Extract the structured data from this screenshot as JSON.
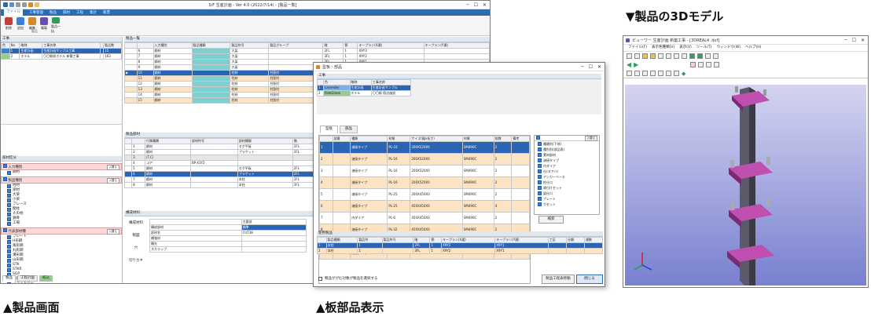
{
  "captions": {
    "product": "▲製品画面",
    "plate": "▲板部品表示",
    "model3d": "▼製品の3Dモデル"
  },
  "main": {
    "title": "S/F 生産計画 - Ver 4.0 (2022/7/14) - [製品一覧]",
    "menus": [
      {
        "label": "ファイル",
        "active": true
      },
      {
        "label": "工事管理",
        "active": false
      },
      {
        "label": "製品",
        "active": false
      },
      {
        "label": "部材",
        "active": false
      },
      {
        "label": "工程",
        "active": false
      },
      {
        "label": "集計",
        "active": false
      },
      {
        "label": "帳票",
        "active": false
      }
    ],
    "ribbon": [
      {
        "label": "削除",
        "color": "#c04040"
      },
      {
        "label": "追加",
        "color": "#3a7fd6"
      },
      {
        "label": "編集",
        "color": "#d08a2c"
      },
      {
        "label": "複製",
        "color": "#6a4fb3"
      },
      {
        "label": "製品一括",
        "color": "#2e9d5b"
      }
    ],
    "ribbon_group": "製品",
    "left": {
      "koji_title": "工事",
      "koji_headers": [
        "色",
        "No",
        "略称",
        "工事名称",
        "",
        "製品数"
      ],
      "koji_rows": [
        {
          "color": "#3a7fd6",
          "no": "1",
          "abbr": "生産計画",
          "name": "生産計画サンプル工事",
          "count": "15",
          "sel": true
        },
        {
          "color": "#8cd08c",
          "no": "2",
          "abbr": "ホテル",
          "name": "〇〇駅前ホテル 新築工事",
          "count": "163",
          "sel": false
        }
      ],
      "filter_title": "部材区分",
      "sections": [
        {
          "label": "入力種別",
          "button": "入替え",
          "items": [
            "鋼材"
          ]
        },
        {
          "label": "製品種別",
          "button": "入替え",
          "items": [
            "柱材",
            "梁材",
            "大梁",
            "小梁",
            "ブレース",
            "間柱",
            "その他",
            "鉄骨",
            "工場"
          ]
        },
        {
          "label": "代表部材種",
          "button": "入替え",
          "items": [
            "プレート",
            "H形鋼",
            "角形鋼",
            "丸形鋼",
            "溝形鋼",
            "山形鋼",
            "STK",
            "STKR",
            "SGP",
            "平鋼",
            "フラットバー"
          ]
        }
      ],
      "bottom_tabs": [
        "製品",
        "工程計画",
        "絞込"
      ]
    },
    "product_list": {
      "title": "製品一覧",
      "headers": [
        "",
        "",
        "入力種別",
        "製品種類",
        "製品符号",
        "製品グループ",
        "階",
        "節",
        "キープラン(X通)",
        "キープラン(Y通)"
      ],
      "rows": [
        {
          "no": "6",
          "type": "鋼材",
          "kind": "大梁",
          "group": "",
          "floor": "2FL",
          "set": "1",
          "kx": "X9Y3",
          "style": "teal"
        },
        {
          "no": "7",
          "type": "鋼材",
          "kind": "大梁",
          "group": "",
          "floor": "3FL",
          "set": "1",
          "kx": "X9Y2",
          "style": "teal"
        },
        {
          "no": "8",
          "type": "鋼材",
          "kind": "大梁",
          "group": "",
          "floor": "2FL",
          "set": "1",
          "kx": "X9Y1",
          "style": "teal"
        },
        {
          "no": "9",
          "type": "鋼材",
          "kind": "大梁",
          "group": "",
          "floor": "3FL",
          "set": "1",
          "kx": "X9Y1",
          "style": "teal"
        },
        {
          "no": "10",
          "type": "鋼材",
          "kind": "柱材",
          "group": "柱割付",
          "floor": "2FL",
          "set": "1",
          "kx": "X1Y2",
          "style": "sel"
        },
        {
          "no": "11",
          "type": "鋼材",
          "kind": "柱材",
          "group": "柱割付",
          "floor": "2FL",
          "set": "1",
          "kx": "X1Y2",
          "style": "alt"
        },
        {
          "no": "12",
          "type": "鋼材",
          "kind": "柱材",
          "group": "柱割付",
          "floor": "2FL",
          "set": "1",
          "kx": "X1Y2",
          "style": "teal"
        },
        {
          "no": "13",
          "type": "鋼材",
          "kind": "柱材",
          "group": "柱割付",
          "floor": "2FL",
          "set": "1",
          "kx": "X1Y2",
          "style": "alt"
        },
        {
          "no": "14",
          "type": "鋼材",
          "kind": "柱材",
          "group": "柱割付",
          "floor": "3FL",
          "set": "1",
          "kx": "X1Y2",
          "style": "teal"
        },
        {
          "no": "15",
          "type": "鋼材",
          "kind": "柱材",
          "group": "柱割付",
          "floor": "3FL",
          "set": "1",
          "kx": "X9Y2",
          "style": "alt"
        }
      ]
    },
    "parts_list": {
      "title": "製品部材",
      "headers": [
        "",
        "",
        "付属種類",
        "部材符号",
        "部材種類",
        "階",
        "節",
        "キープラン(X通)",
        "キープラン(Y通)"
      ],
      "rows": [
        {
          "no": "1",
          "type": "鋼材",
          "code": "",
          "kind": "セグ平板",
          "floor": "2FL",
          "set": "1",
          "kx": "X9Y2",
          "style": ""
        },
        {
          "no": "2",
          "type": "鋼材",
          "code": "",
          "kind": "プラケット",
          "floor": "2FL",
          "set": "1",
          "kx": "X9Y2",
          "style": ""
        },
        {
          "no": "3",
          "type": "(T.C)",
          "code": "",
          "kind": "",
          "floor": "",
          "set": "",
          "kx": "",
          "style": "grey"
        },
        {
          "no": "4",
          "type": "コア",
          "code": "BP-X3Y2",
          "kind": "",
          "floor": "",
          "set": "",
          "kx": "",
          "style": ""
        },
        {
          "no": "5",
          "type": "鋼材",
          "code": "",
          "kind": "セグ平板",
          "floor": "2FL",
          "set": "1",
          "kx": "X9Y2",
          "style": ""
        },
        {
          "no": "6",
          "type": "鋼材",
          "code": "",
          "kind": "プラケット",
          "floor": "2FL",
          "set": "1",
          "kx": "X9Y2",
          "style": "sel"
        },
        {
          "no": "7",
          "type": "鋼材",
          "code": "",
          "kind": "本柱",
          "floor": "2FL",
          "set": "1",
          "kx": "X9Y2",
          "style": ""
        },
        {
          "no": "8",
          "type": "鋼材",
          "code": "",
          "kind": "本柱",
          "floor": "3FL",
          "set": "1",
          "kx": "X9Y2",
          "style": ""
        }
      ]
    },
    "info": {
      "title": "構成材料",
      "left_labels": [
        "構成材料",
        "製図",
        "穴",
        "切りカキ"
      ],
      "header": "主要部",
      "rows": [
        {
          "label": "構成部材",
          "value": "標準",
          "sel": true
        },
        {
          "label": "部材名",
          "value": "CUT38",
          "sel": false
        },
        {
          "label": "補強材",
          "value": "",
          "sel": false
        },
        {
          "label": "開先",
          "value": "",
          "sel": false
        },
        {
          "label": "スカラップ",
          "value": "",
          "sel": false
        }
      ]
    }
  },
  "dialog": {
    "title": "型板・部品",
    "koji_title": "工事",
    "koji_headers": [
      "",
      "色",
      "略称",
      "工事名称"
    ],
    "koji_rows": [
      {
        "no": "1",
        "color": "#7ab0e8",
        "colorname": "Lavender",
        "abbr": "生産計画",
        "name": "生産計画サンプル",
        "sel": true
      },
      {
        "no": "2",
        "color": "#98c898",
        "colorname": "PaleGreen",
        "abbr": "ホテル",
        "name": "〇〇駅 宿泊施設",
        "sel": false
      }
    ],
    "tabs": [
      "型板",
      "部品"
    ],
    "headers": [
      "",
      "部番",
      "種類",
      "材質",
      "サイズ(幅x長さ)",
      "材質",
      "枚数",
      "備考"
    ],
    "rows": [
      {
        "no": "1",
        "kind": "溶接タイプ",
        "mat": "PL-16",
        "size": "200X520X0",
        "grade": "SM490C",
        "qty": "2",
        "style": "sel"
      },
      {
        "no": "2",
        "kind": "溶接タイプ",
        "mat": "PL-16",
        "size": "200X520X0",
        "grade": "SM490C",
        "qty": "2",
        "style": "alt"
      },
      {
        "no": "3",
        "kind": "溶接タイプ",
        "mat": "PL-16",
        "size": "200X520X0",
        "grade": "SM490C",
        "qty": "2",
        "style": ""
      },
      {
        "no": "4",
        "kind": "溶接タイプ",
        "mat": "PL-16",
        "size": "200X520X0",
        "grade": "SM490C",
        "qty": "2",
        "style": "alt"
      },
      {
        "no": "5",
        "kind": "溶接タイプ",
        "mat": "PL-25",
        "size": "200X450X0",
        "grade": "SM490C",
        "qty": "2",
        "style": ""
      },
      {
        "no": "6",
        "kind": "溶接タイプ",
        "mat": "PL-25",
        "size": "450X450X0",
        "grade": "SM490C",
        "qty": "4",
        "style": "alt"
      },
      {
        "no": "7",
        "kind": "内ダイア",
        "mat": "PL-6",
        "size": "450X450X0",
        "grade": "SM490C",
        "qty": "2",
        "style": ""
      },
      {
        "no": "8",
        "kind": "溶接タイプ",
        "mat": "PL-32",
        "size": "450X450X0",
        "grade": "SM490C",
        "qty": "2",
        "style": "alt"
      },
      {
        "no": "9",
        "kind": "溶接タイプ",
        "mat": "PL-32",
        "size": "450X450X0",
        "grade": "SM490C",
        "qty": "2",
        "style": ""
      },
      {
        "no": "10",
        "kind": "溶接タイプ",
        "mat": "PL-32",
        "size": "450X450X0",
        "grade": "SM490C",
        "qty": "2",
        "style": "alt"
      }
    ],
    "checklist_button": "入替え",
    "checklist": [
      "種類別(下地)",
      "種別別(部品表)",
      "素材部材",
      "溶接タイプ",
      "内ダイア",
      "仕口(アバ)",
      "アンカーベース",
      "柱仕口",
      "建付けセット",
      "梁仕口",
      "プレート",
      "ガセット"
    ],
    "search_button": "検索",
    "used_title": "使用製品",
    "used_headers": [
      "",
      "製品種類",
      "製品符",
      "製品符号",
      "階",
      "節",
      "キープラン(X通)",
      "キープラン(Y通)",
      "工区",
      "分類",
      "通数"
    ],
    "used_rows": [
      {
        "no": "1",
        "kind": "本柱",
        "n": "1",
        "floor": "2FL",
        "set": "1",
        "kx": "X9Y2",
        "ky": "X9Y1",
        "style": "sel"
      },
      {
        "no": "2",
        "kind": "本柱",
        "n": "1",
        "floor": "3FL",
        "set": "1",
        "kx": "X9Y2",
        "ky": "X9Y1",
        "style": "alt"
      }
    ],
    "checkbox_label": "製品ががむ対象が製品を選択する",
    "goto_button": "製品工程表移動",
    "close_button": "閉じる"
  },
  "viewer": {
    "title": "ビューワー 生産計画 新築工事 - [3DREAL4 .dxf]",
    "menus": [
      "ファイル(F)",
      "表示色種類(V)",
      "表示(V)",
      "ツール(T)",
      "ウィンドウ(W)",
      "ヘルプ(H)"
    ],
    "bg_top": "#d4d4f0",
    "bg_bottom": "#7880d0"
  }
}
